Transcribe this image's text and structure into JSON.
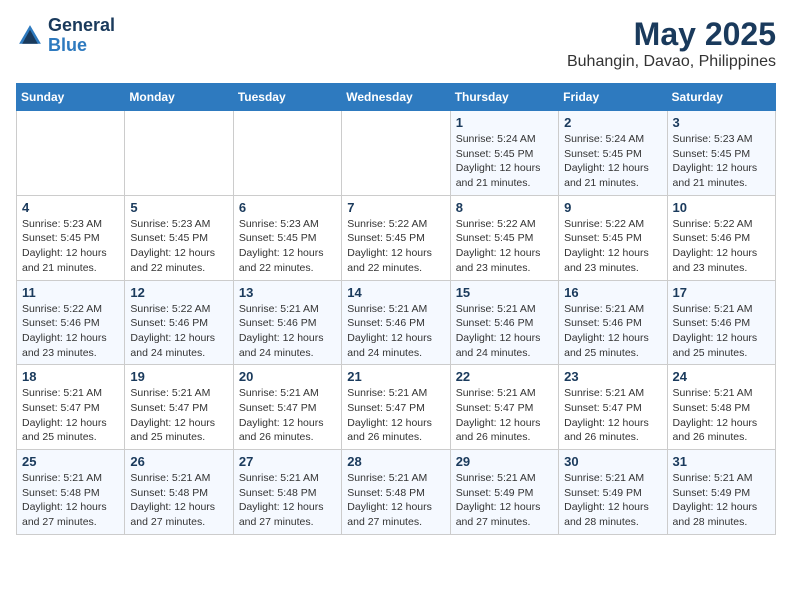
{
  "header": {
    "logo_line1": "General",
    "logo_line2": "Blue",
    "title": "May 2025",
    "subtitle": "Buhangin, Davao, Philippines"
  },
  "days_of_week": [
    "Sunday",
    "Monday",
    "Tuesday",
    "Wednesday",
    "Thursday",
    "Friday",
    "Saturday"
  ],
  "weeks": [
    [
      {
        "day": "",
        "info": ""
      },
      {
        "day": "",
        "info": ""
      },
      {
        "day": "",
        "info": ""
      },
      {
        "day": "",
        "info": ""
      },
      {
        "day": "1",
        "info": "Sunrise: 5:24 AM\nSunset: 5:45 PM\nDaylight: 12 hours\nand 21 minutes."
      },
      {
        "day": "2",
        "info": "Sunrise: 5:24 AM\nSunset: 5:45 PM\nDaylight: 12 hours\nand 21 minutes."
      },
      {
        "day": "3",
        "info": "Sunrise: 5:23 AM\nSunset: 5:45 PM\nDaylight: 12 hours\nand 21 minutes."
      }
    ],
    [
      {
        "day": "4",
        "info": "Sunrise: 5:23 AM\nSunset: 5:45 PM\nDaylight: 12 hours\nand 21 minutes."
      },
      {
        "day": "5",
        "info": "Sunrise: 5:23 AM\nSunset: 5:45 PM\nDaylight: 12 hours\nand 22 minutes."
      },
      {
        "day": "6",
        "info": "Sunrise: 5:23 AM\nSunset: 5:45 PM\nDaylight: 12 hours\nand 22 minutes."
      },
      {
        "day": "7",
        "info": "Sunrise: 5:22 AM\nSunset: 5:45 PM\nDaylight: 12 hours\nand 22 minutes."
      },
      {
        "day": "8",
        "info": "Sunrise: 5:22 AM\nSunset: 5:45 PM\nDaylight: 12 hours\nand 23 minutes."
      },
      {
        "day": "9",
        "info": "Sunrise: 5:22 AM\nSunset: 5:45 PM\nDaylight: 12 hours\nand 23 minutes."
      },
      {
        "day": "10",
        "info": "Sunrise: 5:22 AM\nSunset: 5:46 PM\nDaylight: 12 hours\nand 23 minutes."
      }
    ],
    [
      {
        "day": "11",
        "info": "Sunrise: 5:22 AM\nSunset: 5:46 PM\nDaylight: 12 hours\nand 23 minutes."
      },
      {
        "day": "12",
        "info": "Sunrise: 5:22 AM\nSunset: 5:46 PM\nDaylight: 12 hours\nand 24 minutes."
      },
      {
        "day": "13",
        "info": "Sunrise: 5:21 AM\nSunset: 5:46 PM\nDaylight: 12 hours\nand 24 minutes."
      },
      {
        "day": "14",
        "info": "Sunrise: 5:21 AM\nSunset: 5:46 PM\nDaylight: 12 hours\nand 24 minutes."
      },
      {
        "day": "15",
        "info": "Sunrise: 5:21 AM\nSunset: 5:46 PM\nDaylight: 12 hours\nand 24 minutes."
      },
      {
        "day": "16",
        "info": "Sunrise: 5:21 AM\nSunset: 5:46 PM\nDaylight: 12 hours\nand 25 minutes."
      },
      {
        "day": "17",
        "info": "Sunrise: 5:21 AM\nSunset: 5:46 PM\nDaylight: 12 hours\nand 25 minutes."
      }
    ],
    [
      {
        "day": "18",
        "info": "Sunrise: 5:21 AM\nSunset: 5:47 PM\nDaylight: 12 hours\nand 25 minutes."
      },
      {
        "day": "19",
        "info": "Sunrise: 5:21 AM\nSunset: 5:47 PM\nDaylight: 12 hours\nand 25 minutes."
      },
      {
        "day": "20",
        "info": "Sunrise: 5:21 AM\nSunset: 5:47 PM\nDaylight: 12 hours\nand 26 minutes."
      },
      {
        "day": "21",
        "info": "Sunrise: 5:21 AM\nSunset: 5:47 PM\nDaylight: 12 hours\nand 26 minutes."
      },
      {
        "day": "22",
        "info": "Sunrise: 5:21 AM\nSunset: 5:47 PM\nDaylight: 12 hours\nand 26 minutes."
      },
      {
        "day": "23",
        "info": "Sunrise: 5:21 AM\nSunset: 5:47 PM\nDaylight: 12 hours\nand 26 minutes."
      },
      {
        "day": "24",
        "info": "Sunrise: 5:21 AM\nSunset: 5:48 PM\nDaylight: 12 hours\nand 26 minutes."
      }
    ],
    [
      {
        "day": "25",
        "info": "Sunrise: 5:21 AM\nSunset: 5:48 PM\nDaylight: 12 hours\nand 27 minutes."
      },
      {
        "day": "26",
        "info": "Sunrise: 5:21 AM\nSunset: 5:48 PM\nDaylight: 12 hours\nand 27 minutes."
      },
      {
        "day": "27",
        "info": "Sunrise: 5:21 AM\nSunset: 5:48 PM\nDaylight: 12 hours\nand 27 minutes."
      },
      {
        "day": "28",
        "info": "Sunrise: 5:21 AM\nSunset: 5:48 PM\nDaylight: 12 hours\nand 27 minutes."
      },
      {
        "day": "29",
        "info": "Sunrise: 5:21 AM\nSunset: 5:49 PM\nDaylight: 12 hours\nand 27 minutes."
      },
      {
        "day": "30",
        "info": "Sunrise: 5:21 AM\nSunset: 5:49 PM\nDaylight: 12 hours\nand 28 minutes."
      },
      {
        "day": "31",
        "info": "Sunrise: 5:21 AM\nSunset: 5:49 PM\nDaylight: 12 hours\nand 28 minutes."
      }
    ]
  ]
}
